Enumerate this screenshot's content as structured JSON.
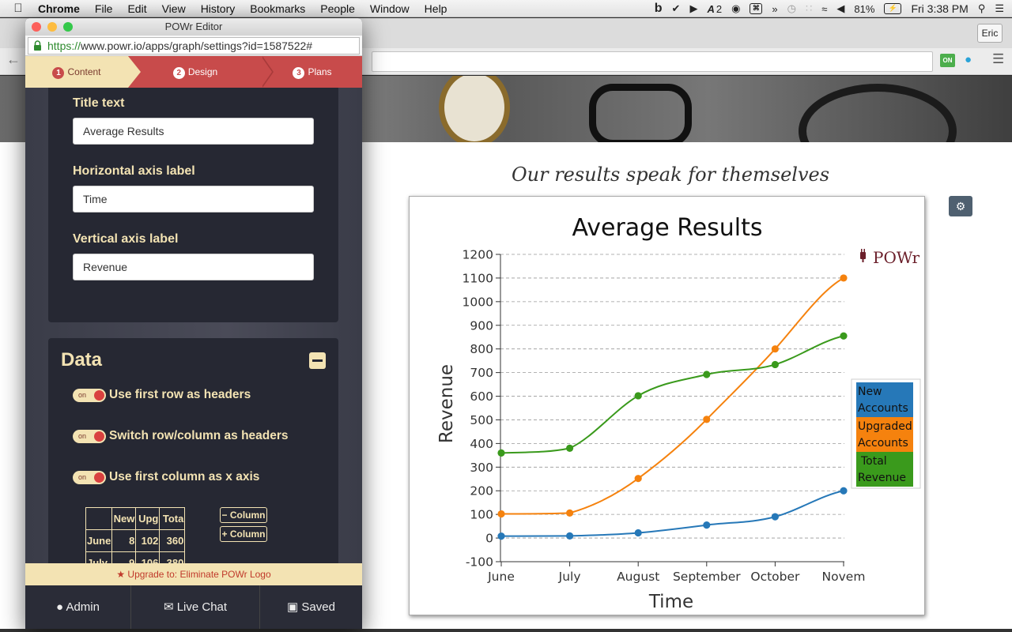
{
  "menubar": {
    "app": "Chrome",
    "items": [
      "File",
      "Edit",
      "View",
      "History",
      "Bookmarks",
      "People",
      "Window",
      "Help"
    ],
    "tray": {
      "adobe_count": "2",
      "battery": "81%",
      "clock": "Fri 3:38 PM"
    }
  },
  "browser": {
    "user": "Eric",
    "ext_on_label": "ON"
  },
  "editor": {
    "window_title": "POWr Editor",
    "url_scheme": "https://",
    "url_rest": "www.powr.io/apps/graph/settings?id=1587522#",
    "steps": [
      {
        "num": "1",
        "label": "Content"
      },
      {
        "num": "2",
        "label": "Design"
      },
      {
        "num": "3",
        "label": "Plans"
      }
    ],
    "fields": {
      "title_label": "Title text",
      "title_value": "Average Results",
      "haxis_label": "Horizontal axis label",
      "haxis_value": "Time",
      "vaxis_label": "Vertical axis label",
      "vaxis_value": "Revenue"
    },
    "data_section": {
      "heading": "Data",
      "toggle_on": "on",
      "toggles": [
        "Use first row as headers",
        "Switch row/column as headers",
        "Use first column as x axis"
      ],
      "grid": [
        [
          "",
          "New",
          "Upg",
          "Tota"
        ],
        [
          "June",
          "8",
          "102",
          "360"
        ],
        [
          "July",
          "9",
          "106",
          "380"
        ]
      ],
      "remove_column": "− Column",
      "add_column": "+ Column"
    },
    "upgrade_text": "★ Upgrade to: Eliminate POWr Logo",
    "footer": {
      "admin": "Admin",
      "chat": "Live Chat",
      "saved": "Saved"
    }
  },
  "page": {
    "tagline": "Our results speak for themselves",
    "brand": "POWr"
  },
  "chart_data": {
    "type": "line",
    "title": "Average Results",
    "xlabel": "Time",
    "ylabel": "Revenue",
    "categories": [
      "June",
      "July",
      "August",
      "September",
      "October",
      "Novem"
    ],
    "ylim": [
      -100,
      1200
    ],
    "yticks": [
      -100,
      0,
      100,
      200,
      300,
      400,
      500,
      600,
      700,
      800,
      900,
      1000,
      1100,
      1200
    ],
    "grid": true,
    "legend_position": "right",
    "series": [
      {
        "name": "New Accounts",
        "color": "#2678b8",
        "values": [
          8,
          9,
          22,
          55,
          90,
          200
        ]
      },
      {
        "name": "Upgraded Accounts",
        "color": "#f5820e",
        "values": [
          102,
          106,
          252,
          502,
          800,
          1100
        ]
      },
      {
        "name": "Total Revenue",
        "color": "#3a9a1c",
        "values": [
          360,
          380,
          602,
          692,
          734,
          855
        ]
      }
    ]
  }
}
